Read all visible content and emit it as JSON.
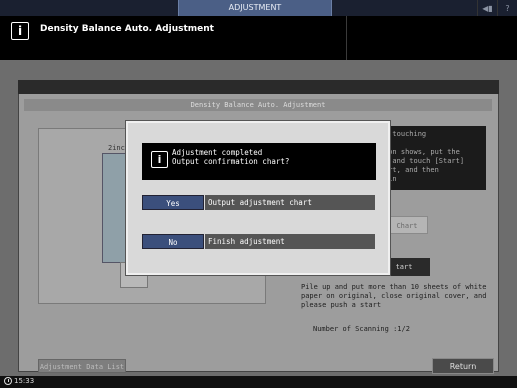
{
  "topbar": {
    "tab_label": "ADJUSTMENT",
    "icons": [
      "speaker-icon",
      "help-icon"
    ],
    "help_glyph": "?",
    "speaker_glyph": "◀▮"
  },
  "header": {
    "title": "Density Balance Auto. Adjustment",
    "info_glyph": "i"
  },
  "screen": {
    "subtitle": "Density Balance Auto. Adjustment",
    "chart_label": "2inc",
    "right_text": "y touching\n\nron shows, put the\n, and touch [Start]\nart, and then\nain",
    "chart_button": "Chart",
    "start_button": "tart",
    "info": "Pile up and put more than 10 sheets of white paper on original, close original cover, and please push a start",
    "scan_label": "Number of Scanning :1/2",
    "adjustment_list": "Adjustment Data List",
    "return_button": "Return"
  },
  "dialog": {
    "line1": "Adjustment completed",
    "line2": "Output confirmation chart?",
    "info_glyph": "i",
    "yes_label": "Yes",
    "yes_desc": "Output adjustment chart",
    "no_label": "No",
    "no_desc": "Finish adjustment"
  },
  "status": {
    "time": "15:33"
  }
}
